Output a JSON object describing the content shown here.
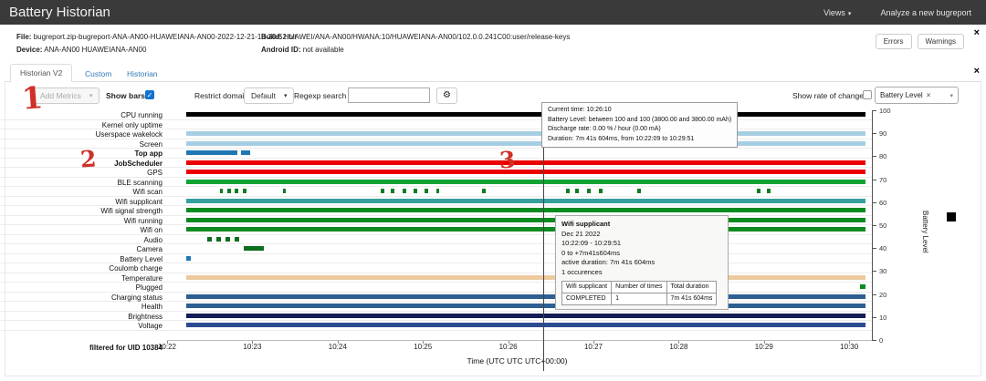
{
  "header": {
    "title": "Battery Historian",
    "views_label": "Views",
    "analyze_label": "Analyze a new bugreport"
  },
  "icons": {
    "caret_down": "▾",
    "close": "×",
    "gear": "⚙",
    "check": "✓"
  },
  "info_bar": {
    "file_label": "File:",
    "file_value": "bugreport.zip-bugreport-ANA-AN00-HUAWEIANA-AN00-2022-12-21-18-30-52.txt",
    "device_label": "Device:",
    "device_value": "ANA-AN00 HUAWEIANA-AN00",
    "build_label": "Build:",
    "build_value": "HUAWEI/ANA-AN00/HWANA:10/HUAWEIANA-AN00/102.0.0.241C00:user/release-keys",
    "android_id_label": "Android ID:",
    "android_id_value": "not available",
    "errors_button": "Errors",
    "warnings_button": "Warnings"
  },
  "tabs": [
    {
      "label": "Historian V2",
      "active": true
    },
    {
      "label": "Custom",
      "active": false
    },
    {
      "label": "Historian",
      "active": false
    }
  ],
  "toolbar": {
    "add_metrics_label": "Add Metrics",
    "show_bars_label": "Show bars",
    "show_bars_checked": true,
    "restrict_domain_label": "Restrict domain",
    "domain_value": "Default",
    "regexp_label": "Regexp search",
    "regexp_value": "",
    "show_rate_label": "Show rate of change",
    "show_rate_checked": false,
    "battery_select_value": "Battery Level"
  },
  "annotations": [
    "1",
    "2",
    "3"
  ],
  "chart_data": {
    "type": "timeline",
    "x_ticks": [
      "10:22",
      "10:23",
      "10:24",
      "10:25",
      "10:26",
      "10:27",
      "10:28",
      "10:29",
      "10:30"
    ],
    "x_label": "Time (UTC UTC UTC+00:00)",
    "y_ticks": [
      "100",
      "90",
      "80",
      "70",
      "60",
      "50",
      "40",
      "30",
      "20",
      "10",
      "0"
    ],
    "y_axis_label": "Battery Level",
    "filtered_label": "filtered for UID 10384",
    "hover_time": "10:26:10",
    "rows": [
      {
        "label": "CPU running",
        "bold": false,
        "color": "#000000",
        "segments": [
          [
            0.028,
            0.997
          ]
        ]
      },
      {
        "label": "Kernel only uptime",
        "bold": false,
        "color": "#a6cee3",
        "segments": []
      },
      {
        "label": "Userspace wakelock",
        "bold": false,
        "color": "#a6cee3",
        "segments": [
          [
            0.028,
            0.997
          ]
        ]
      },
      {
        "label": "Screen",
        "bold": false,
        "color": "#a6cee3",
        "segments": [
          [
            0.028,
            0.997
          ]
        ]
      },
      {
        "label": "Top app",
        "bold": true,
        "color": "#1f78b4",
        "segments": [
          [
            0.028,
            0.1
          ],
          [
            0.106,
            0.118
          ]
        ]
      },
      {
        "label": "JobScheduler",
        "bold": true,
        "color": "#eb0000",
        "segments": [
          [
            0.028,
            0.997
          ]
        ]
      },
      {
        "label": "GPS",
        "bold": false,
        "color": "#eb0000",
        "segments": [
          [
            0.028,
            0.997
          ]
        ]
      },
      {
        "label": "BLE scanning",
        "bold": false,
        "color": "#0fa433",
        "segments": [
          [
            0.028,
            0.997
          ]
        ]
      },
      {
        "label": "Wifi scan",
        "bold": false,
        "color": "#0c7d24",
        "segments": [
          [
            0.075,
            0.08
          ],
          [
            0.086,
            0.091
          ],
          [
            0.097,
            0.102
          ],
          [
            0.108,
            0.113
          ],
          [
            0.165,
            0.17
          ],
          [
            0.305,
            0.31
          ],
          [
            0.32,
            0.325
          ],
          [
            0.336,
            0.341
          ],
          [
            0.352,
            0.357
          ],
          [
            0.368,
            0.373
          ],
          [
            0.384,
            0.389
          ],
          [
            0.45,
            0.455
          ],
          [
            0.57,
            0.575
          ],
          [
            0.583,
            0.588
          ],
          [
            0.6,
            0.605
          ],
          [
            0.617,
            0.622
          ],
          [
            0.672,
            0.677
          ],
          [
            0.842,
            0.847
          ],
          [
            0.857,
            0.862
          ]
        ]
      },
      {
        "label": "Wifi supplicant",
        "bold": false,
        "color": "#35a09b",
        "segments": [
          [
            0.028,
            0.997
          ]
        ]
      },
      {
        "label": "Wifi signal strength",
        "bold": false,
        "color": "#0c8a20",
        "segments": [
          [
            0.028,
            0.997
          ]
        ]
      },
      {
        "label": "Wifi running",
        "bold": false,
        "color": "#0c8a20",
        "segments": [
          [
            0.028,
            0.997
          ]
        ]
      },
      {
        "label": "Wifi on",
        "bold": false,
        "color": "#0c8a20",
        "segments": [
          [
            0.028,
            0.997
          ]
        ]
      },
      {
        "label": "Audio",
        "bold": false,
        "color": "#0b6e1d",
        "segments": [
          [
            0.058,
            0.064
          ],
          [
            0.071,
            0.077
          ],
          [
            0.084,
            0.09
          ],
          [
            0.097,
            0.103
          ]
        ]
      },
      {
        "label": "Camera",
        "bold": false,
        "color": "#0b6e1d",
        "segments": [
          [
            0.11,
            0.138
          ]
        ]
      },
      {
        "label": "Battery Level",
        "bold": false,
        "color": "#1f78b4",
        "segments": [
          [
            0.028,
            0.034
          ]
        ]
      },
      {
        "label": "Coulomb charge",
        "bold": false,
        "color": "#1f78b4",
        "segments": []
      },
      {
        "label": "Temperature",
        "bold": false,
        "color": "#edca9e",
        "segments": [
          [
            0.028,
            0.997
          ]
        ]
      },
      {
        "label": "Plugged",
        "bold": false,
        "color": "#0c8a20",
        "segments": [
          [
            0.99,
            0.997
          ]
        ]
      },
      {
        "label": "Charging status",
        "bold": false,
        "color": "#2d5f92",
        "segments": [
          [
            0.028,
            0.997
          ]
        ]
      },
      {
        "label": "Health",
        "bold": false,
        "color": "#2d5f92",
        "segments": [
          [
            0.028,
            0.997
          ]
        ]
      },
      {
        "label": "Brightness",
        "bold": false,
        "color": "#141d55",
        "segments": [
          [
            0.028,
            0.997
          ]
        ]
      },
      {
        "label": "Voltage",
        "bold": false,
        "color": "#2c4b90",
        "segments": [
          [
            0.028,
            0.997
          ]
        ]
      }
    ]
  },
  "tooltips": {
    "current_time": {
      "lines": [
        "Current time: 10:26:10",
        "Battery Level: between 100 and 100 (3800.00 and 3800.00 mAh)",
        "Discharge rate: 0.00 % / hour (0.00 mA)",
        "Duration: 7m 41s 604ms, from 10:22:09 to 10:29:51"
      ]
    },
    "wifi_supplicant": {
      "title": "Wifi supplicant",
      "lines": [
        "Dec 21 2022",
        "10:22:09 - 10:29:51",
        "0 to +7m41s604ms",
        "active duration: 7m 41s 604ms",
        "1 occurences"
      ],
      "table": {
        "headers": [
          "Wifi supplicant",
          "Number of times",
          "Total duration"
        ],
        "rows": [
          [
            "COMPLETED",
            "1",
            "7m 41s 604ms"
          ]
        ]
      }
    }
  }
}
